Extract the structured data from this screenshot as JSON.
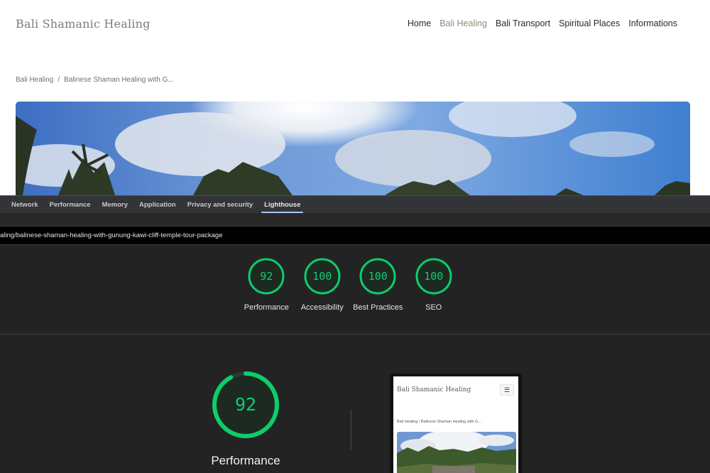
{
  "site": {
    "logo": "Bali Shamanic Healing",
    "nav": {
      "home": "Home",
      "bali_healing": "Bali Healing",
      "bali_transport": "Bali Transport",
      "spiritual_places": "Spiritual Places",
      "informations": "Informations"
    },
    "breadcrumb": {
      "parent": "Bali Healing",
      "separator": "/",
      "current": "Balinese Shaman Healing with G..."
    }
  },
  "devtools": {
    "tabs": [
      "Network",
      "Performance",
      "Memory",
      "Application",
      "Privacy and security",
      "Lighthouse"
    ],
    "active_tab": "Lighthouse",
    "url": "aling/balinese-shaman-healing-with-gunung-kawi-cliff-temple-tour-package",
    "scores": [
      {
        "label": "Performance",
        "value": 92
      },
      {
        "label": "Accessibility",
        "value": 100
      },
      {
        "label": "Best Practices",
        "value": 100
      },
      {
        "label": "SEO",
        "value": 100
      }
    ],
    "main_score": {
      "label": "Performance",
      "value": 92
    },
    "score_color": "#0cce6b",
    "preview": {
      "logo": "Bali Shamanic Healing",
      "menu_icon": "hamburger-icon",
      "breadcrumb": "Bali Healing  /  Balinese Shaman Healing with G..."
    }
  }
}
